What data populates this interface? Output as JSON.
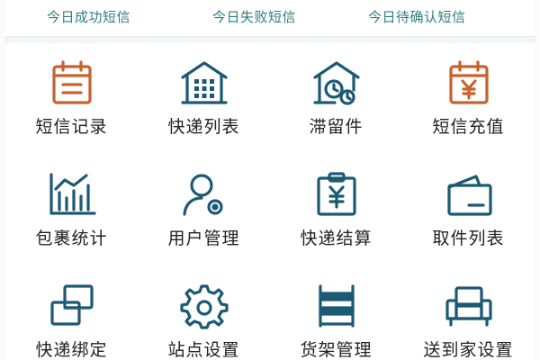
{
  "stats": {
    "success_sms": "今日成功短信",
    "failed_sms": "今日失败短信",
    "pending_sms": "今日待确认短信"
  },
  "menu": [
    {
      "label": "短信记录",
      "icon": "calendar-icon",
      "color": "#c8622e"
    },
    {
      "label": "快递列表",
      "icon": "warehouse-icon",
      "color": "#1c5a74"
    },
    {
      "label": "滞留件",
      "icon": "house-clock-icon",
      "color": "#1c5a74"
    },
    {
      "label": "短信充值",
      "icon": "yen-calendar-icon",
      "color": "#c8622e"
    },
    {
      "label": "包裹统计",
      "icon": "bar-chart-icon",
      "color": "#1c5a74"
    },
    {
      "label": "用户管理",
      "icon": "user-settings-icon",
      "color": "#1c5a74"
    },
    {
      "label": "快递结算",
      "icon": "yen-clipboard-icon",
      "color": "#1c5a74"
    },
    {
      "label": "取件列表",
      "icon": "wallet-icon",
      "color": "#1c5a74"
    },
    {
      "label": "快递绑定",
      "icon": "link-squares-icon",
      "color": "#1c5a74"
    },
    {
      "label": "站点设置",
      "icon": "gear-icon",
      "color": "#1c5a74"
    },
    {
      "label": "货架管理",
      "icon": "shelf-icon",
      "color": "#1c5a74"
    },
    {
      "label": "送到家设置",
      "icon": "sofa-icon",
      "color": "#1c5a74"
    }
  ],
  "colors": {
    "accent_teal": "#2f7d7d",
    "icon_blue": "#1c5a74",
    "icon_orange": "#c8622e"
  }
}
